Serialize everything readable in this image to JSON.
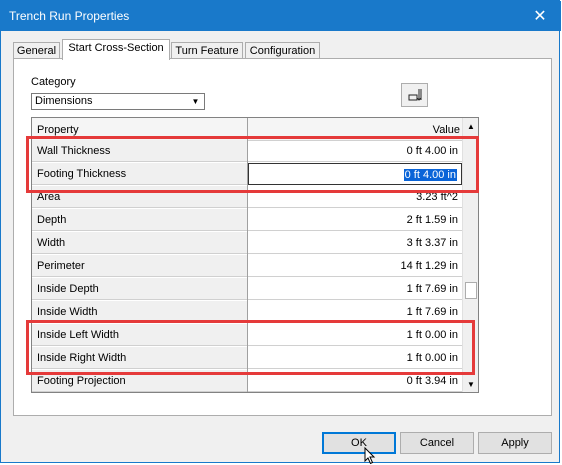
{
  "window": {
    "title": "Trench Run Properties",
    "close_glyph": "✕"
  },
  "tabs": [
    {
      "label": "General",
      "active": false
    },
    {
      "label": "Start Cross-Section",
      "active": true
    },
    {
      "label": "Turn Feature",
      "active": false
    },
    {
      "label": "Configuration",
      "active": false
    }
  ],
  "category": {
    "label": "Category",
    "selected": "Dimensions",
    "sort_icon": "sort-icon"
  },
  "grid": {
    "columns": {
      "property": "Property",
      "value": "Value"
    },
    "rows": [
      {
        "name": "Wall Thickness",
        "value": "0 ft  4.00 in"
      },
      {
        "name": "Footing Thickness",
        "value": "0 ft  4.00 in"
      },
      {
        "name": "Area",
        "value": "3.23 ft^2"
      },
      {
        "name": "Depth",
        "value": "2 ft  1.59 in"
      },
      {
        "name": "Width",
        "value": "3 ft  3.37 in"
      },
      {
        "name": "Perimeter",
        "value": "14 ft  1.29 in"
      },
      {
        "name": "Inside Depth",
        "value": "1 ft  7.69 in"
      },
      {
        "name": "Inside Width",
        "value": "1 ft  7.69 in"
      },
      {
        "name": "Inside Left Width",
        "value": "1 ft  0.00 in"
      },
      {
        "name": "Inside Right Width",
        "value": "1 ft  0.00 in"
      },
      {
        "name": "Footing Projection",
        "value": "0 ft  3.94 in"
      }
    ],
    "editing_row_index": 1
  },
  "buttons": {
    "ok": "OK",
    "cancel": "Cancel",
    "apply": "Apply"
  },
  "colors": {
    "titlebar": "#1979ca",
    "highlight": "#e53a3a",
    "selection": "#0a64d8"
  }
}
